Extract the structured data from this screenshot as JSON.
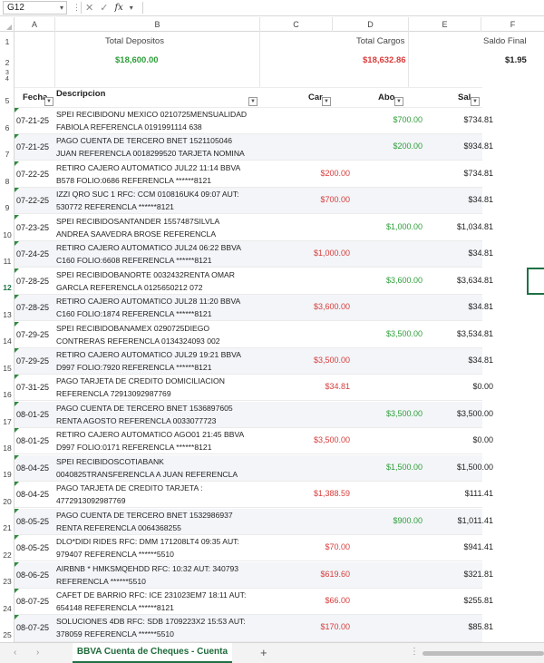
{
  "formula_bar": {
    "cell_ref": "G12",
    "fx": "fx"
  },
  "columns": [
    "A",
    "B",
    "C",
    "D",
    "E",
    "F"
  ],
  "rows": [
    "1",
    "2",
    "3",
    "4",
    "5",
    "6",
    "7",
    "8",
    "9",
    "10",
    "11",
    "12",
    "13",
    "14",
    "15",
    "16",
    "17",
    "18",
    "19",
    "20",
    "21",
    "22",
    "23",
    "24",
    "25"
  ],
  "summary": {
    "depositos_label": "Total Depositos",
    "depositos_value": "$18,600.00",
    "cargos_label": "Total Cargos",
    "cargos_value": "$18,632.86",
    "saldo_label": "Saldo Final",
    "saldo_value": "$1.95"
  },
  "summary_colors": {
    "deposit": "#2e9e3a",
    "charge": "#d93b3b"
  },
  "table": {
    "headers": {
      "fecha": "Fecha",
      "descripcion": "Descripcion",
      "cargo": "Car",
      "abono": "Abo",
      "saldo": "Sal"
    },
    "rows": [
      {
        "fecha": "07-21-25",
        "desc1": "SPEI RECIBIDONU MEXICO 0210725MENSUALIDAD",
        "desc2": "FABIOLA REFERENCLA 0191991114 638",
        "cargo": "",
        "abono": "$700.00",
        "saldo": "$734.81"
      },
      {
        "fecha": "07-21-25",
        "desc1": "PAGO CUENTA DE TERCERO BNET 1521105046",
        "desc2": "JUAN REFERENCLA 0018299520 TARJETA NOMINA",
        "cargo": "",
        "abono": "$200.00",
        "saldo": "$934.81"
      },
      {
        "fecha": "07-22-25",
        "desc1": "RETIRO CAJERO AUTOMATICO JUL22 11:14 BBVA",
        "desc2": "B578 FOLIO:0686 REFERENCLA ******8121",
        "cargo": "$200.00",
        "abono": "",
        "saldo": "$734.81"
      },
      {
        "fecha": "07-22-25",
        "desc1": "IZZI QRO SUC 1 RFC: CCM 010816UK4 09:07 AUT:",
        "desc2": "530772 REFERENCLA ******8121",
        "cargo": "$700.00",
        "abono": "",
        "saldo": "$34.81"
      },
      {
        "fecha": "07-23-25",
        "desc1": "SPEI RECIBIDOSANTANDER 1557487SILVLA",
        "desc2": "ANDREA SAAVEDRA BROSE REFERENCLA",
        "cargo": "",
        "abono": "$1,000.00",
        "saldo": "$1,034.81"
      },
      {
        "fecha": "07-24-25",
        "desc1": "RETIRO CAJERO AUTOMATICO JUL24 06:22 BBVA",
        "desc2": "C160 FOLIO:6608 REFERENCLA ******8121",
        "cargo": "$1,000.00",
        "abono": "",
        "saldo": "$34.81"
      },
      {
        "fecha": "07-28-25",
        "desc1": "SPEI RECIBIDOBANORTE 0032432RENTA OMAR",
        "desc2": "GARCLA REFERENCLA 0125650212 072",
        "cargo": "",
        "abono": "$3,600.00",
        "saldo": "$3,634.81"
      },
      {
        "fecha": "07-28-25",
        "desc1": "RETIRO CAJERO AUTOMATICO JUL28 11:20 BBVA",
        "desc2": "C160 FOLIO:1874 REFERENCLA ******8121",
        "cargo": "$3,600.00",
        "abono": "",
        "saldo": "$34.81"
      },
      {
        "fecha": "07-29-25",
        "desc1": "SPEI RECIBIDOBANAMEX 0290725DIEGO",
        "desc2": "CONTRERAS REFERENCLA 0134324093 002",
        "cargo": "",
        "abono": "$3,500.00",
        "saldo": "$3,534.81"
      },
      {
        "fecha": "07-29-25",
        "desc1": "RETIRO CAJERO AUTOMATICO JUL29 19:21 BBVA",
        "desc2": "D997 FOLIO:7920 REFERENCLA ******8121",
        "cargo": "$3,500.00",
        "abono": "",
        "saldo": "$34.81"
      },
      {
        "fecha": "07-31-25",
        "desc1": "PAGO TARJETA DE CREDITO DOMICILIACION",
        "desc2": "REFERENCLA 72913092987769",
        "cargo": "$34.81",
        "abono": "",
        "saldo": "$0.00"
      },
      {
        "fecha": "08-01-25",
        "desc1": "PAGO CUENTA DE TERCERO BNET 1536897605",
        "desc2": "RENTA AGOSTO REFERENCLA 0033077723",
        "cargo": "",
        "abono": "$3,500.00",
        "saldo": "$3,500.00"
      },
      {
        "fecha": "08-01-25",
        "desc1": "RETIRO CAJERO AUTOMATICO AGO01 21:45 BBVA",
        "desc2": "D997 FOLIO:0171 REFERENCLA ******8121",
        "cargo": "$3,500.00",
        "abono": "",
        "saldo": "$0.00"
      },
      {
        "fecha": "08-04-25",
        "desc1": "SPEI RECIBIDOSCOTIABANK",
        "desc2": "0040825TRANSFERENCLA A JUAN REFERENCLA",
        "cargo": "",
        "abono": "$1,500.00",
        "saldo": "$1,500.00"
      },
      {
        "fecha": "08-04-25",
        "desc1": "PAGO TARJETA DE CREDITO TARJETA :",
        "desc2": "4772913092987769",
        "cargo": "$1,388.59",
        "abono": "",
        "saldo": "$111.41"
      },
      {
        "fecha": "08-05-25",
        "desc1": "PAGO CUENTA DE TERCERO BNET 1532986937",
        "desc2": "RENTA REFERENCLA 0064368255",
        "cargo": "",
        "abono": "$900.00",
        "saldo": "$1,011.41"
      },
      {
        "fecha": "08-05-25",
        "desc1": "DLO*DIDI RIDES RFC: DMM 171208LT4 09:35 AUT:",
        "desc2": "979407 REFERENCLA ******5510",
        "cargo": "$70.00",
        "abono": "",
        "saldo": "$941.41"
      },
      {
        "fecha": "08-06-25",
        "desc1": "AIRBNB * HMKSMQEHDD RFC: 10:32 AUT: 340793",
        "desc2": "REFERENCLA ******5510",
        "cargo": "$619.60",
        "abono": "",
        "saldo": "$321.81"
      },
      {
        "fecha": "08-07-25",
        "desc1": "CAFET DE BARRIO RFC: ICE 231023EM7 18:11 AUT:",
        "desc2": "654148 REFERENCLA ******8121",
        "cargo": "$66.00",
        "abono": "",
        "saldo": "$255.81"
      },
      {
        "fecha": "08-07-25",
        "desc1": "SOLUCIONES 4DB RFC: SDB 1709223X2 15:53 AUT:",
        "desc2": "378059 REFERENCLA ******5510",
        "cargo": "$170.00",
        "abono": "",
        "saldo": "$85.81"
      }
    ]
  },
  "sheet_tab": {
    "label": "BBVA Cuenta de Cheques - Cuenta",
    "add_label": "+",
    "more_label": "⋮"
  },
  "icons": [
    "cancel-icon",
    "confirm-icon",
    "function-icon",
    "chevron-down-icon",
    "filter-dropdown-icon",
    "prev-sheet-icon",
    "next-sheet-icon"
  ]
}
